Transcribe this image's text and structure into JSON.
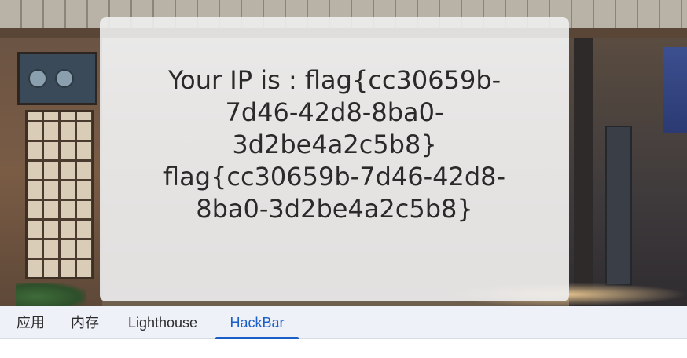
{
  "page": {
    "message_lines": [
      "Your IP is : flag{cc30659b-",
      "7d46-42d8-8ba0-",
      "3d2be4a2c5b8}",
      "flag{cc30659b-7d46-42d8-",
      "8ba0-3d2be4a2c5b8}"
    ]
  },
  "devtools": {
    "tabs": [
      {
        "label": "应用",
        "active": false
      },
      {
        "label": "内存",
        "active": false
      },
      {
        "label": "Lighthouse",
        "active": false
      },
      {
        "label": "HackBar",
        "active": true
      }
    ],
    "active_color": "#1a5fc8"
  }
}
